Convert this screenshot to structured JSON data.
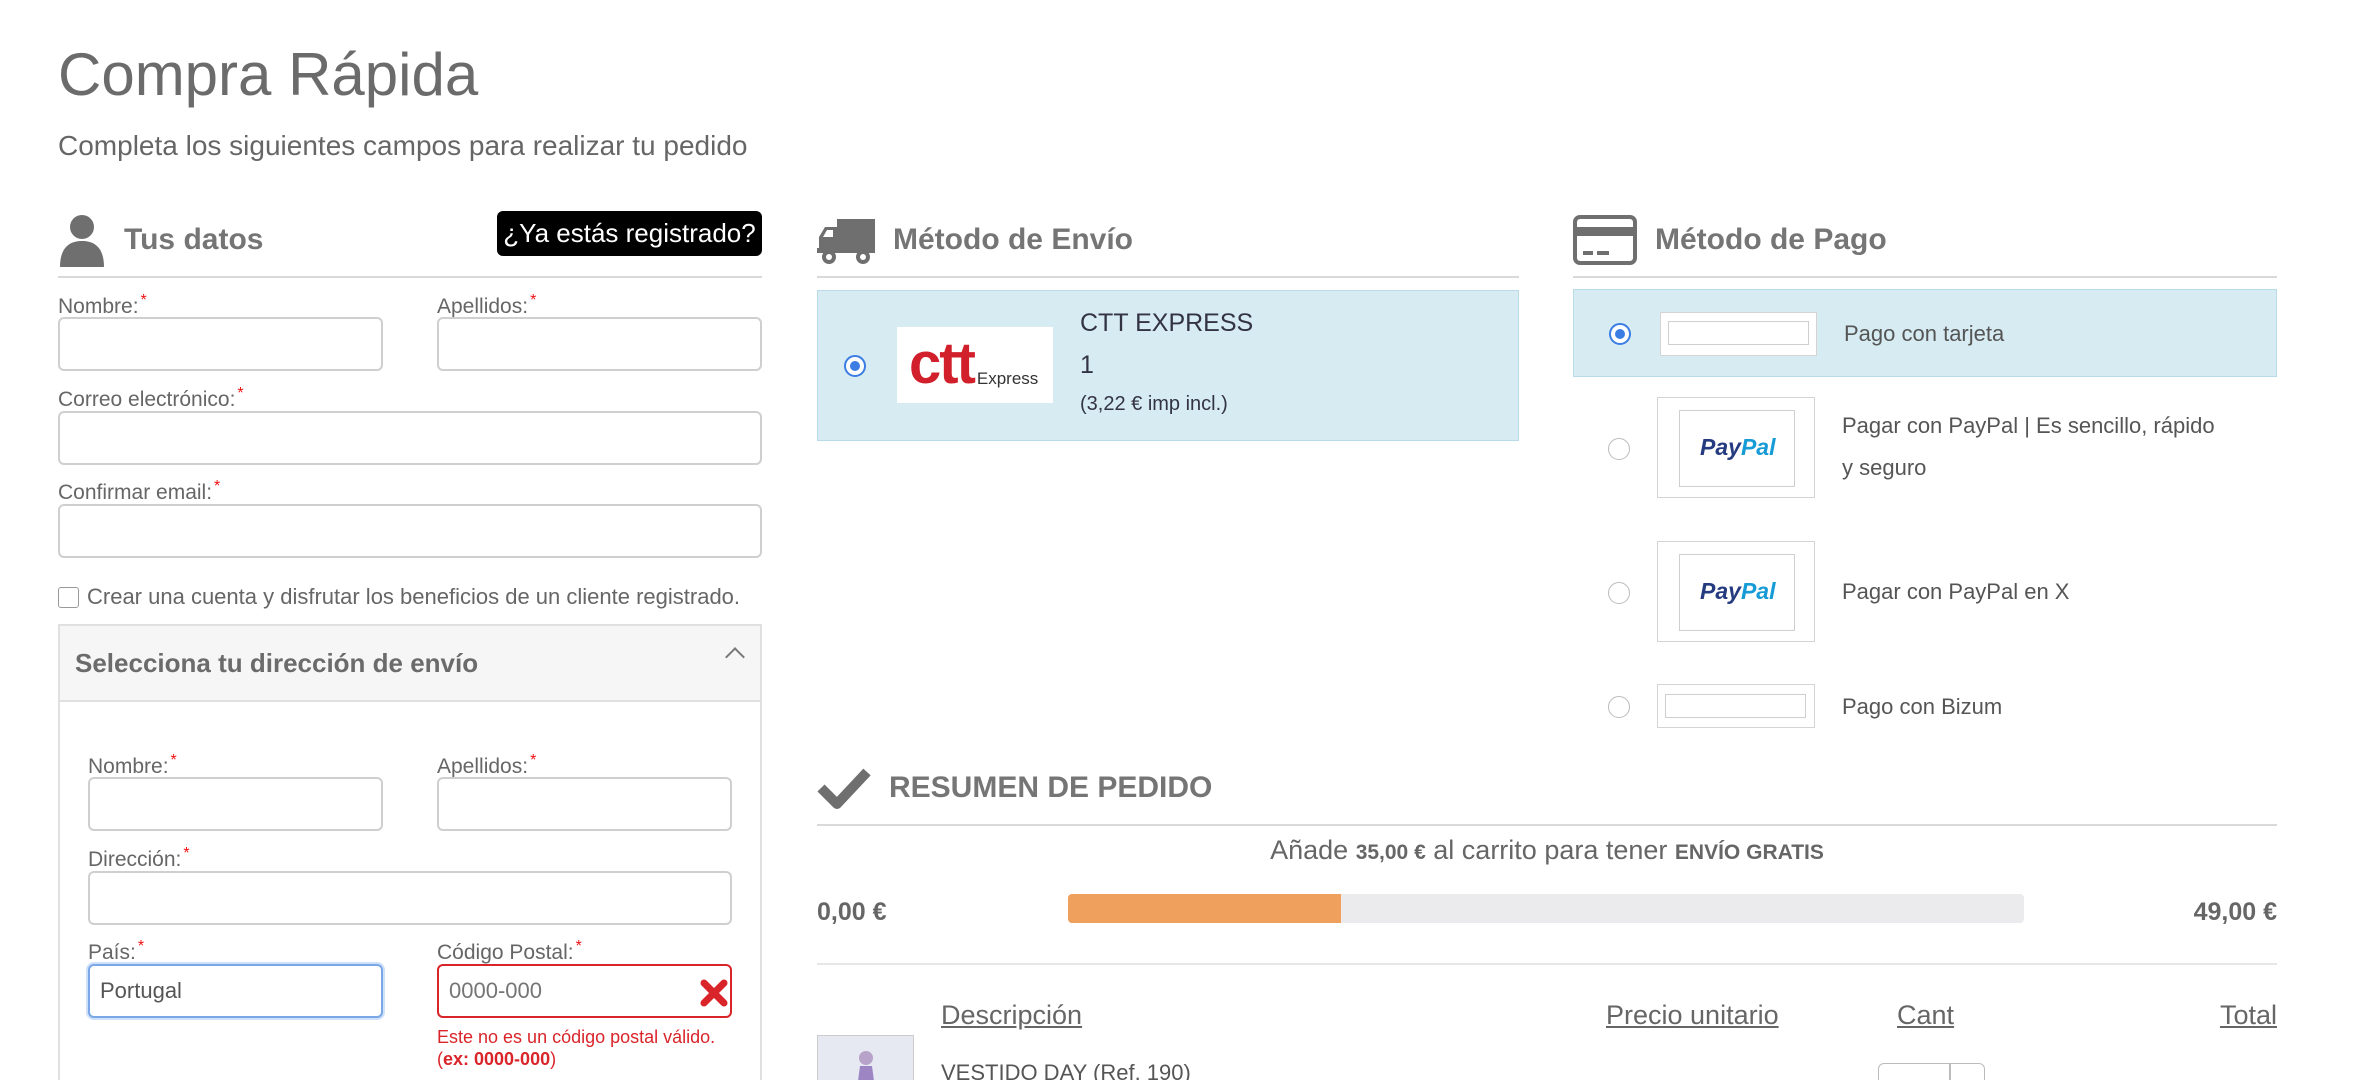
{
  "header": {
    "title": "Compra Rápida",
    "subtitle": "Completa los siguientes campos para realizar tu pedido"
  },
  "datos": {
    "title": "Tus datos",
    "login_button": "¿Ya estás registrado?",
    "nombre_label": "Nombre:",
    "apellidos_label": "Apellidos:",
    "email_label": "Correo electrónico:",
    "confirm_email_label": "Confirmar email:",
    "required_mark": "*",
    "create_account_label": "Crear una cuenta y disfrutar los beneficios de un cliente registrado."
  },
  "direccion": {
    "title": "Selecciona tu dirección de envío",
    "nombre_label": "Nombre:",
    "apellidos_label": "Apellidos:",
    "direccion_label": "Dirección:",
    "pais_label": "País:",
    "pais_value": "Portugal",
    "cp_label": "Código Postal:",
    "cp_placeholder": "0000-000",
    "cp_error_text": "Este no es un código postal válido.",
    "cp_error_open": "(",
    "cp_error_example": "ex: 0000-000",
    "cp_error_close": ")"
  },
  "envio": {
    "title": "Método de Envío",
    "option": {
      "logo_text": "ctt",
      "logo_sub": "Express",
      "name": "CTT EXPRESS",
      "qty": "1",
      "price": "(3,22 € imp incl.)",
      "selected": true
    }
  },
  "pago": {
    "title": "Método de Pago",
    "options": [
      {
        "label": "Pago con tarjeta",
        "selected": true
      },
      {
        "label_line1": "Pagar con PayPal | Es sencillo, rápido",
        "label_line2": "y seguro",
        "logo_a": "Pay",
        "logo_b": "Pal",
        "selected": false
      },
      {
        "label": "Pagar con PayPal en X",
        "logo_a": "Pay",
        "logo_b": "Pal",
        "selected": false
      },
      {
        "label": "Pago con Bizum",
        "selected": false
      }
    ]
  },
  "resumen": {
    "title": "RESUMEN DE PEDIDO",
    "promo_pre": "Añade",
    "promo_amount": "35,00 €",
    "promo_mid": "al carrito para tener",
    "promo_free": "ENVÍO GRATIS",
    "progress_min": "0,00 €",
    "progress_max": "49,00 €",
    "progress_fraction": 0.286,
    "columns": {
      "descripcion": "Descripción",
      "precio": "Precio unitario",
      "cant": "Cant",
      "total": "Total"
    },
    "items": [
      {
        "name": "VESTIDO DAY (Ref. 190)"
      }
    ]
  },
  "colors": {
    "accent_blue": "#3b7de3",
    "selected_bg": "#d6ebf2",
    "error_red": "#d9252a",
    "progress_orange": "#f0a05d"
  }
}
